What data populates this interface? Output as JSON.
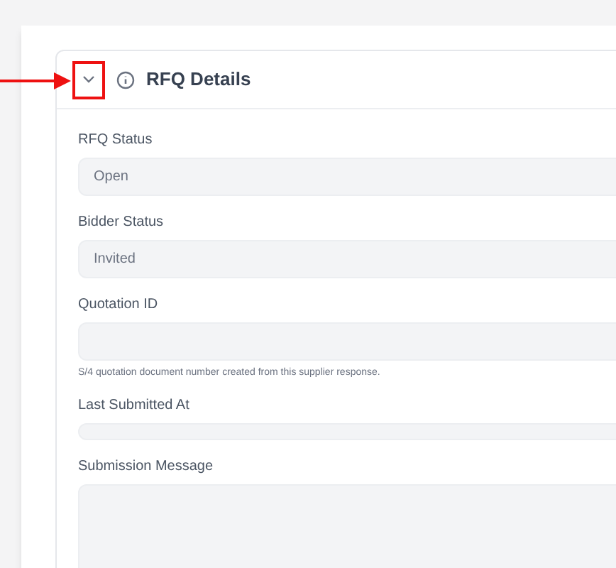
{
  "section": {
    "title": "RFQ Details",
    "expanded": true
  },
  "fields": [
    {
      "label": "RFQ Status",
      "value": "Open",
      "kind": "input"
    },
    {
      "label": "Bidder Status",
      "value": "Invited",
      "kind": "input"
    },
    {
      "label": "Quotation ID",
      "kind": "input",
      "hint": "S/4 quotation document number created from this supplier response."
    },
    {
      "label": "Last Submitted At",
      "kind": "compact"
    },
    {
      "label": "Submission Message",
      "kind": "textarea"
    }
  ]
}
